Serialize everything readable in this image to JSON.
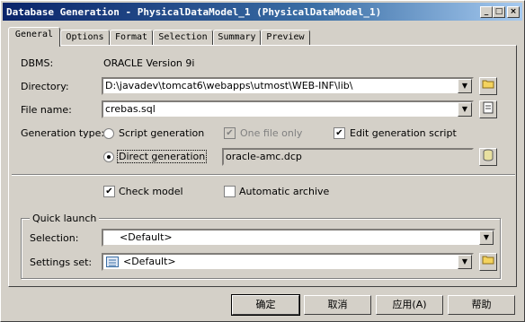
{
  "window": {
    "title": "Database Generation - PhysicalDataModel_1 (PhysicalDataModel_1)"
  },
  "title_buttons": {
    "minimize": "_",
    "maximize": "□",
    "close": "×"
  },
  "tabs": [
    {
      "label": "General"
    },
    {
      "label": "Options"
    },
    {
      "label": "Format"
    },
    {
      "label": "Selection"
    },
    {
      "label": "Summary"
    },
    {
      "label": "Preview"
    }
  ],
  "general": {
    "dbms_label": "DBMS:",
    "dbms_value": "ORACLE Version 9i",
    "directory_label": "Directory:",
    "directory_value": "D:\\javadev\\tomcat6\\webapps\\utmost\\WEB-INF\\lib\\",
    "filename_label": "File name:",
    "filename_value": "crebas.sql",
    "gentype_label": "Generation type:",
    "script_generation": "Script generation",
    "one_file_only": "One file only",
    "edit_generation_script": "Edit generation script",
    "direct_generation": "Direct generation",
    "connection_value": "oracle-amc.dcp",
    "check_model": "Check model",
    "automatic_archive": "Automatic archive"
  },
  "quick_launch": {
    "legend": "Quick launch",
    "selection_label": "Selection:",
    "selection_value": "<Default>",
    "settings_label": "Settings set:",
    "settings_value": "<Default>"
  },
  "buttons": {
    "ok": "确定",
    "cancel": "取消",
    "apply": "应用(A)",
    "help": "帮助"
  },
  "state": {
    "generation_type": "Direct generation",
    "one_file_only_checked": true,
    "one_file_only_enabled": false,
    "edit_generation_script_checked": true,
    "check_model_checked": true,
    "automatic_archive_checked": false
  },
  "icons": {
    "folder": "folder-icon",
    "properties": "properties-icon",
    "connection": "connection-icon",
    "settings_list": "list-icon"
  }
}
